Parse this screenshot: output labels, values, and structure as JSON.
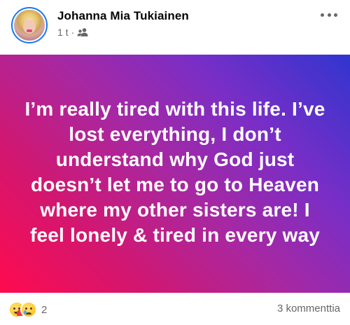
{
  "header": {
    "author_name": "Johanna Mia Tukiainen",
    "time": "1 t",
    "separator": "·",
    "audience_icon": "friends-icon",
    "more_icon": "more-horizontal-icon"
  },
  "post": {
    "text": "I’m really tired with this life. I’ve lost everything, I don’t understand why God just doesn’t let me to go to Heaven where my other sisters are! I feel lonely & tired in every way",
    "background_colors": [
      "#ff0a4f",
      "#a628a3",
      "#3135cf"
    ]
  },
  "footer": {
    "reactions": [
      "care-reaction-icon",
      "sad-reaction-icon"
    ],
    "reaction_count": "2",
    "comments": "3 kommenttia"
  }
}
